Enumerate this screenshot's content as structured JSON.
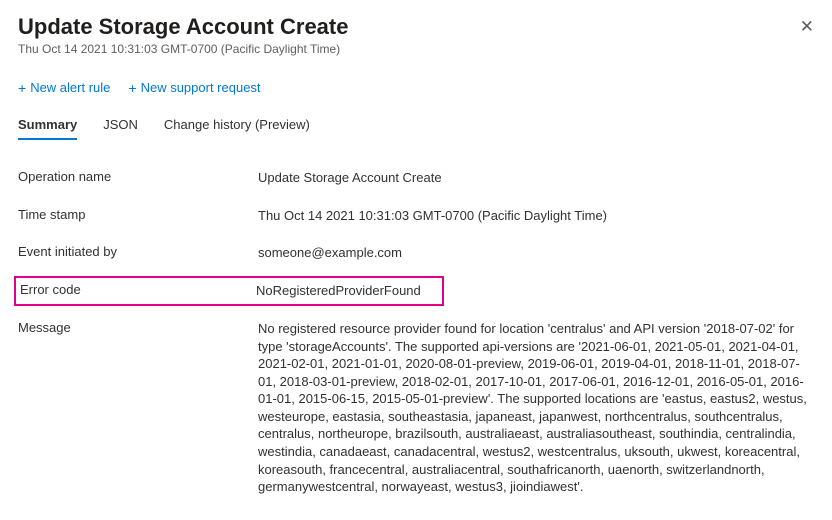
{
  "header": {
    "title": "Update Storage Account Create",
    "timestamp": "Thu Oct 14 2021 10:31:03 GMT-0700 (Pacific Daylight Time)"
  },
  "actions": {
    "new_alert": "New alert rule",
    "new_support": "New support request"
  },
  "tabs": {
    "summary": "Summary",
    "json": "JSON",
    "change_history": "Change history (Preview)"
  },
  "details": {
    "operation_name": {
      "label": "Operation name",
      "value": "Update Storage Account Create"
    },
    "time_stamp": {
      "label": "Time stamp",
      "value": "Thu Oct 14 2021 10:31:03 GMT-0700 (Pacific Daylight Time)"
    },
    "event_initiated_by": {
      "label": "Event initiated by",
      "value": "someone@example.com"
    },
    "error_code": {
      "label": "Error code",
      "value": "NoRegisteredProviderFound"
    },
    "message": {
      "label": "Message",
      "value": "No registered resource provider found for location 'centralus' and API version '2018-07-02' for type 'storageAccounts'. The supported api-versions are '2021-06-01, 2021-05-01, 2021-04-01, 2021-02-01, 2021-01-01, 2020-08-01-preview, 2019-06-01, 2019-04-01, 2018-11-01, 2018-07-01, 2018-03-01-preview, 2018-02-01, 2017-10-01, 2017-06-01, 2016-12-01, 2016-05-01, 2016-01-01, 2015-06-15, 2015-05-01-preview'. The supported locations are 'eastus, eastus2, westus, westeurope, eastasia, southeastasia, japaneast, japanwest, northcentralus, southcentralus, centralus, northeurope, brazilsouth, australiaeast, australiasoutheast, southindia, centralindia, westindia, canadaeast, canadacentral, westus2, westcentralus, uksouth, ukwest, koreacentral, koreasouth, francecentral, australiacentral, southafricanorth, uaenorth, switzerlandnorth, germanywestcentral, norwayeast, westus3, jioindiawest'."
    }
  }
}
